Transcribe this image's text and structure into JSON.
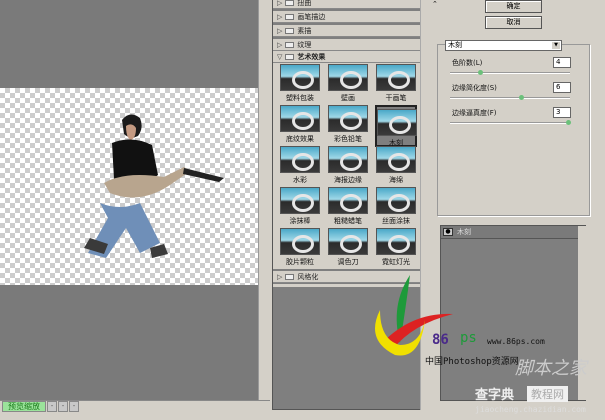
{
  "canvas": {
    "zoom": "预览缩放",
    "zoom_buttons": [
      "-",
      "-",
      "-"
    ]
  },
  "filter_categories": [
    {
      "label": "扭曲"
    },
    {
      "label": "画笔描边"
    },
    {
      "label": "素描"
    },
    {
      "label": "纹理"
    },
    {
      "label": "艺术效果",
      "expanded": true
    },
    {
      "label": "风格化"
    }
  ],
  "filters": [
    "塑料包装",
    "壁画",
    "干画笔",
    "底纹效果",
    "彩色铅笔",
    "木刻",
    "水彩",
    "海报边缘",
    "海绵",
    "涂抹棒",
    "粗糙蜡笔",
    "丝面涂抹",
    "胶片颗粒",
    "调色刀",
    "霓虹灯光"
  ],
  "selected_filter": "木刻",
  "buttons": {
    "ok": "确定",
    "cancel": "取消"
  },
  "dropdown": {
    "value": "木刻"
  },
  "params": [
    {
      "label": "色阶数(L)",
      "value": "4",
      "fraction": 0.25
    },
    {
      "label": "边缘简化度(S)",
      "value": "6",
      "fraction": 0.6
    },
    {
      "label": "边缘逼真度(F)",
      "value": "3",
      "fraction": 1.0
    }
  ],
  "layers": [
    {
      "label": "木刻"
    }
  ],
  "watermarks": {
    "site": "www.86ps.com",
    "brand": "中国Photoshop资源网",
    "num": "86",
    "ps": "ps",
    "jb": "脚本之家",
    "czd": "查字典",
    "czd2": "教程网",
    "czd_url": "jiaocheng.chazidian.com"
  }
}
